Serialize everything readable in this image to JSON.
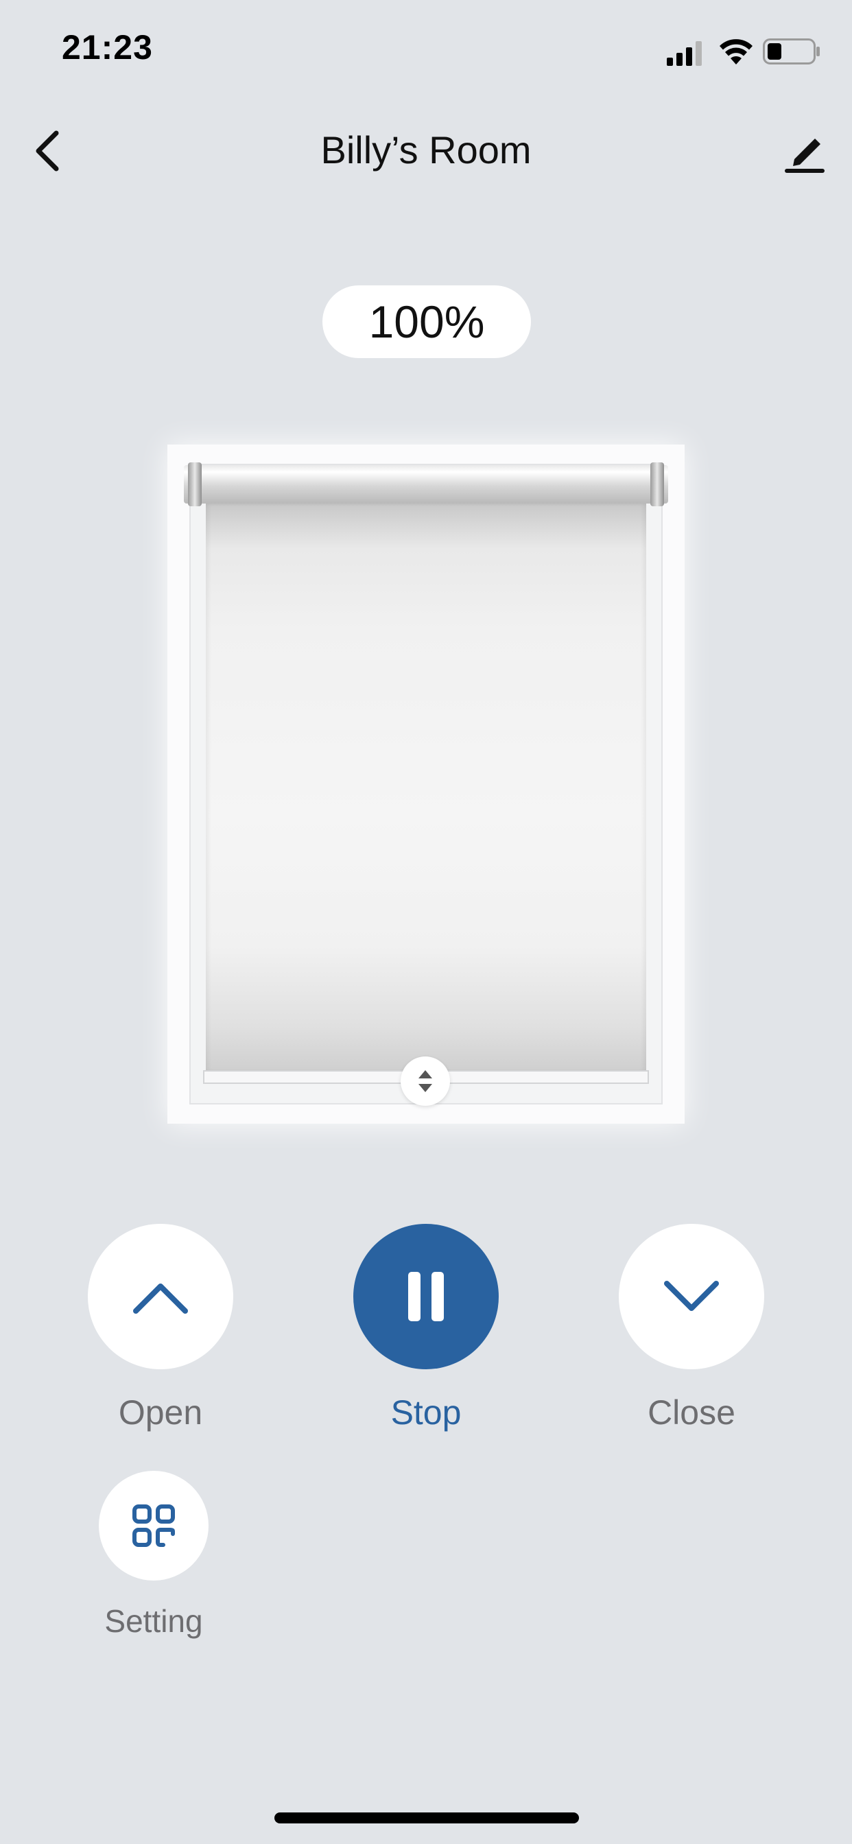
{
  "status_bar": {
    "time": "21:23",
    "signal_icon": "cellular-signal-icon",
    "wifi_icon": "wifi-icon",
    "battery_icon": "battery-icon",
    "battery_level": 0.3
  },
  "nav": {
    "title": "Billy’s Room",
    "back_icon": "chevron-left-icon",
    "edit_icon": "pencil-icon"
  },
  "blind": {
    "position_label": "100%",
    "position_value": 100,
    "handle_icon": "up-down-arrows-icon"
  },
  "controls": {
    "open": {
      "label": "Open",
      "icon": "chevron-up-icon"
    },
    "stop": {
      "label": "Stop",
      "icon": "pause-icon"
    },
    "close": {
      "label": "Close",
      "icon": "chevron-down-icon"
    },
    "setting": {
      "label": "Setting",
      "icon": "grid-icon"
    }
  },
  "colors": {
    "accent": "#2962a0",
    "background": "#e1e4e8",
    "label_gray": "#6d6d70"
  }
}
